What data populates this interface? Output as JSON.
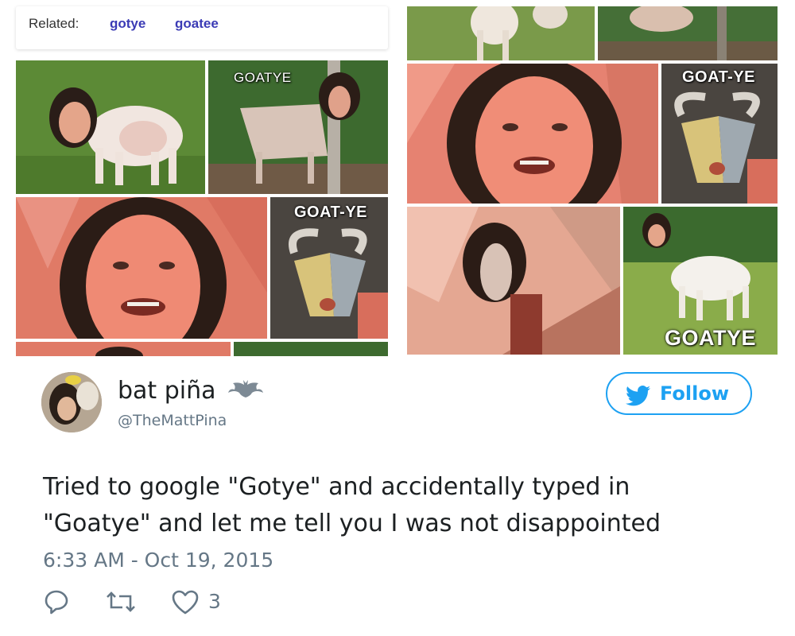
{
  "related": {
    "label": "Related:",
    "links": [
      "gotye",
      "goatee"
    ]
  },
  "collage_captions": {
    "caption_1": "GOATYE",
    "caption_2": "GOAT-YE",
    "caption_3": "GOAT-YE",
    "caption_4": "GOATYE"
  },
  "tweet": {
    "display_name": "bat piña",
    "handle": "@TheMattPina",
    "follow_label": "Follow",
    "text_line_1": "Tried to google \"Gotye\" and accidentally typed in",
    "text_line_2": "\"Goatye\" and let me tell you I was not disappointed",
    "timestamp": "6:33 AM - Oct 19, 2015",
    "like_count": "3"
  },
  "colors": {
    "link": "#3b3bb5",
    "twitter_blue": "#1da1f2",
    "text": "#1c2022",
    "muted": "#657786",
    "skin_pink": "#e8826f",
    "grass": "#5c8a36"
  }
}
